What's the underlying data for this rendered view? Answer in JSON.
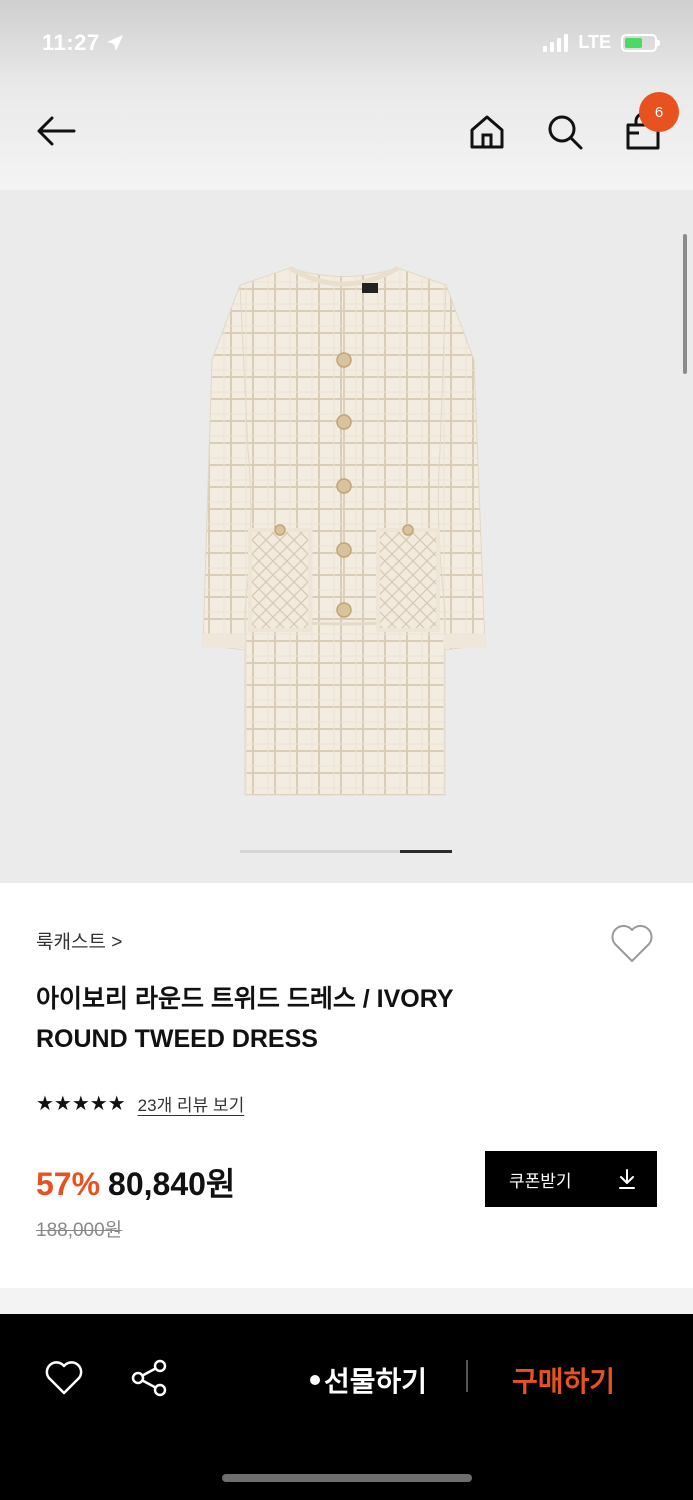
{
  "status_bar": {
    "time": "11:27",
    "network": "LTE",
    "battery_color": "#4cd964"
  },
  "nav": {
    "back_icon": "arrow-left-icon",
    "icons": [
      "home-icon",
      "search-icon",
      "cart-icon"
    ],
    "cart_count": "6",
    "badge_color": "#e8521f"
  },
  "gallery": {
    "image": "ivory-tweed-dress-photo",
    "slide_indicator": "2 of 2"
  },
  "product": {
    "brand": "룩캐스트 >",
    "title": "아이보리 라운드 트위드 드레스 / IVORY ROUND TWEED DRESS",
    "stars": "★★★★★",
    "review_link": "23개 리뷰 보기",
    "discount": "57%",
    "price": "80,840원",
    "original_price": "188,000원",
    "coupon_label": "쿠폰받기"
  },
  "bottom_bar": {
    "gift_label": "선물하기",
    "buy_label": "구매하기",
    "buy_color": "#e8521f"
  }
}
